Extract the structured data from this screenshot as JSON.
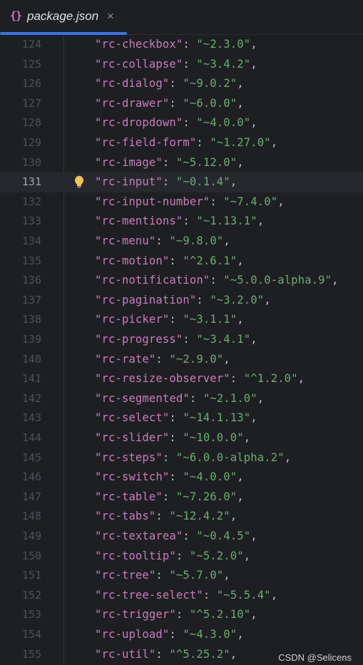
{
  "tab": {
    "icon": "{}",
    "icon_name": "json-braces-icon",
    "filename": "package.json",
    "close": "×"
  },
  "current_line": 131,
  "lines": [
    {
      "n": 124,
      "key": "\"rc-checkbox\"",
      "value": "\"~2.3.0\""
    },
    {
      "n": 125,
      "key": "\"rc-collapse\"",
      "value": "\"~3.4.2\""
    },
    {
      "n": 126,
      "key": "\"rc-dialog\"",
      "value": "\"~9.0.2\""
    },
    {
      "n": 127,
      "key": "\"rc-drawer\"",
      "value": "\"~6.0.0\""
    },
    {
      "n": 128,
      "key": "\"rc-dropdown\"",
      "value": "\"~4.0.0\""
    },
    {
      "n": 129,
      "key": "\"rc-field-form\"",
      "value": "\"~1.27.0\""
    },
    {
      "n": 130,
      "key": "\"rc-image\"",
      "value": "\"~5.12.0\""
    },
    {
      "n": 131,
      "key": "\"rc-input\"",
      "value": "\"~0.1.4\""
    },
    {
      "n": 132,
      "key": "\"rc-input-number\"",
      "value": "\"~7.4.0\""
    },
    {
      "n": 133,
      "key": "\"rc-mentions\"",
      "value": "\"~1.13.1\""
    },
    {
      "n": 134,
      "key": "\"rc-menu\"",
      "value": "\"~9.8.0\""
    },
    {
      "n": 135,
      "key": "\"rc-motion\"",
      "value": "\"^2.6.1\""
    },
    {
      "n": 136,
      "key": "\"rc-notification\"",
      "value": "\"~5.0.0-alpha.9\""
    },
    {
      "n": 137,
      "key": "\"rc-pagination\"",
      "value": "\"~3.2.0\""
    },
    {
      "n": 138,
      "key": "\"rc-picker\"",
      "value": "\"~3.1.1\""
    },
    {
      "n": 139,
      "key": "\"rc-progress\"",
      "value": "\"~3.4.1\""
    },
    {
      "n": 140,
      "key": "\"rc-rate\"",
      "value": "\"~2.9.0\""
    },
    {
      "n": 141,
      "key": "\"rc-resize-observer\"",
      "value": "\"^1.2.0\""
    },
    {
      "n": 142,
      "key": "\"rc-segmented\"",
      "value": "\"~2.1.0\""
    },
    {
      "n": 143,
      "key": "\"rc-select\"",
      "value": "\"~14.1.13\""
    },
    {
      "n": 144,
      "key": "\"rc-slider\"",
      "value": "\"~10.0.0\""
    },
    {
      "n": 145,
      "key": "\"rc-steps\"",
      "value": "\"~6.0.0-alpha.2\""
    },
    {
      "n": 146,
      "key": "\"rc-switch\"",
      "value": "\"~4.0.0\""
    },
    {
      "n": 147,
      "key": "\"rc-table\"",
      "value": "\"~7.26.0\""
    },
    {
      "n": 148,
      "key": "\"rc-tabs\"",
      "value": "\"~12.4.2\""
    },
    {
      "n": 149,
      "key": "\"rc-textarea\"",
      "value": "\"~0.4.5\""
    },
    {
      "n": 150,
      "key": "\"rc-tooltip\"",
      "value": "\"~5.2.0\""
    },
    {
      "n": 151,
      "key": "\"rc-tree\"",
      "value": "\"~5.7.0\""
    },
    {
      "n": 152,
      "key": "\"rc-tree-select\"",
      "value": "\"~5.5.4\""
    },
    {
      "n": 153,
      "key": "\"rc-trigger\"",
      "value": "\"^5.2.10\""
    },
    {
      "n": 154,
      "key": "\"rc-upload\"",
      "value": "\"~4.3.0\""
    },
    {
      "n": 155,
      "key": "\"rc-util\"",
      "value": "\"^5.25.2\""
    }
  ],
  "gutter_icon": "lightbulb-icon",
  "watermark": "CSDN @Selicens",
  "colors": {
    "key": "#c77dbb",
    "value": "#6aab73",
    "tab_accent": "#3574f0",
    "background": "#1e1f22"
  }
}
